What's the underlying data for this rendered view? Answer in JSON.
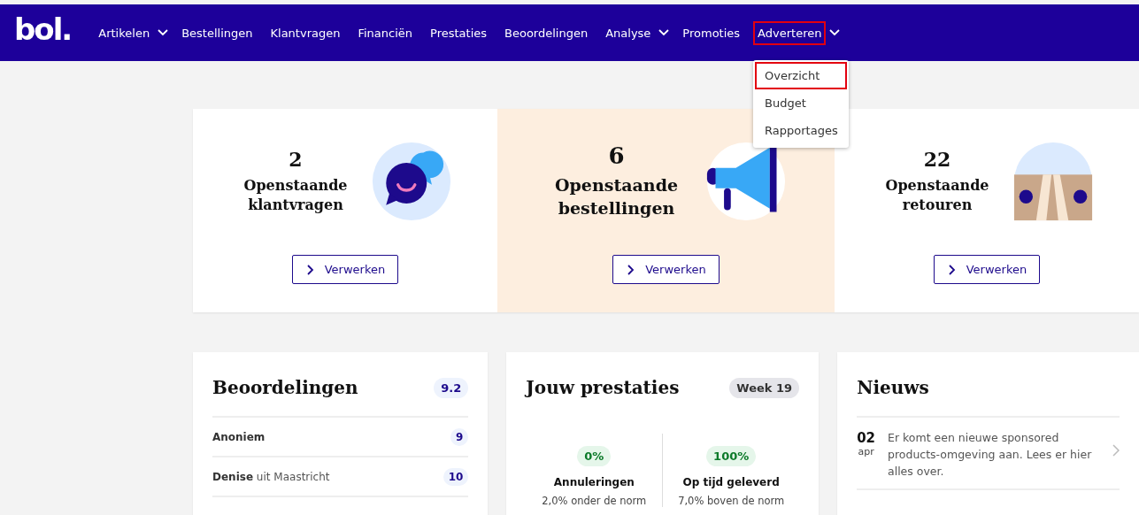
{
  "logo": "bol.",
  "nav": [
    {
      "label": "Artikelen",
      "dropdown": true,
      "highlighted": false
    },
    {
      "label": "Bestellingen",
      "dropdown": false,
      "highlighted": false
    },
    {
      "label": "Klantvragen",
      "dropdown": false,
      "highlighted": false
    },
    {
      "label": "Financiën",
      "dropdown": false,
      "highlighted": false
    },
    {
      "label": "Prestaties",
      "dropdown": false,
      "highlighted": false
    },
    {
      "label": "Beoordelingen",
      "dropdown": false,
      "highlighted": false
    },
    {
      "label": "Analyse",
      "dropdown": true,
      "highlighted": false
    },
    {
      "label": "Promoties",
      "dropdown": false,
      "highlighted": false
    },
    {
      "label": "Adverteren",
      "dropdown": true,
      "highlighted": true
    }
  ],
  "menu": [
    {
      "label": "Overzicht",
      "highlighted": true
    },
    {
      "label": "Budget",
      "highlighted": false
    },
    {
      "label": "Rapportages",
      "highlighted": false
    }
  ],
  "tiles": [
    {
      "count": "2",
      "title": "Openstaande klantvragen",
      "kind": "chat",
      "featured": false,
      "button": "Verwerken"
    },
    {
      "count": "6",
      "title": "Openstaande bestellingen",
      "kind": "megaphone",
      "featured": true,
      "button": "Verwerken"
    },
    {
      "count": "22",
      "title": "Openstaande retouren",
      "kind": "parcel",
      "featured": false,
      "button": "Verwerken"
    }
  ],
  "reviews": {
    "title": "Beoordelingen",
    "score": "9.2",
    "rows": [
      {
        "name": "Anoniem",
        "score": "9"
      },
      {
        "name": "Denise",
        "place": "uit Maastricht",
        "score": "10"
      }
    ]
  },
  "performance": {
    "title": "Jouw prestaties",
    "week": "Week 19",
    "metrics": [
      {
        "value": "0%",
        "label": "Annuleringen",
        "note": "2,0% onder de norm"
      },
      {
        "value": "100%",
        "label": "Op tijd geleverd",
        "note": "7,0% boven de norm"
      }
    ]
  },
  "news": {
    "title": "Nieuws",
    "items": [
      {
        "day": "02",
        "month": "apr",
        "text": "Er komt een nieuwe sponsored products-omgeving aan. Lees er hier alles over."
      }
    ]
  }
}
